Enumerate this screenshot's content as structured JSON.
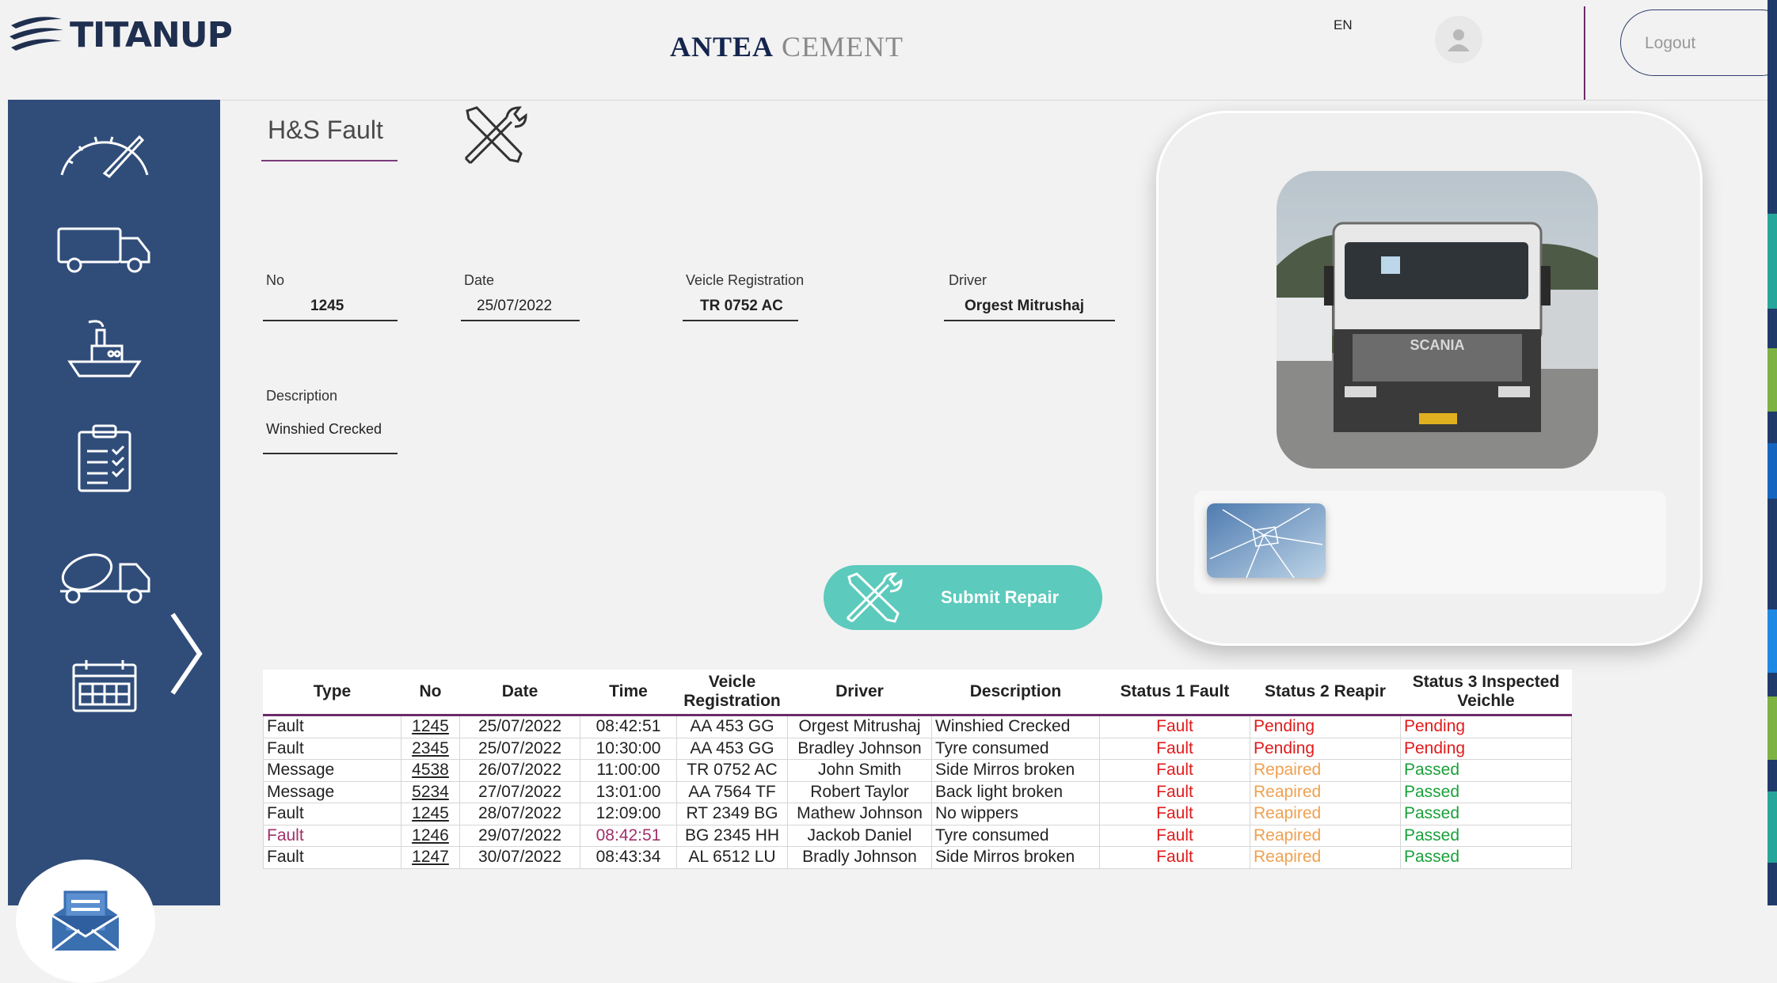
{
  "header": {
    "brand": {
      "name_main": "TITAN",
      "name_tail": "UP"
    },
    "company": {
      "part1": "ANTEA",
      "part2": "CEMENT"
    },
    "language": "EN",
    "logout_label": "Logout"
  },
  "sidebar": {
    "items": [
      {
        "icon": "speedometer-icon"
      },
      {
        "icon": "truck-icon"
      },
      {
        "icon": "ship-icon"
      },
      {
        "icon": "clipboard-checklist-icon"
      },
      {
        "icon": "cement-mixer-icon"
      },
      {
        "icon": "calendar-icon"
      }
    ],
    "expand_icon": "chevron-right-icon",
    "mail_icon": "mail-document-icon"
  },
  "form": {
    "title": "H&S Fault",
    "no": {
      "label": "No",
      "value": "1245"
    },
    "date": {
      "label": "Date",
      "value": "25/07/2022"
    },
    "registration": {
      "label": "Veicle Registration",
      "value": "TR 0752 AC"
    },
    "driver": {
      "label": "Driver",
      "value": "Orgest Mitrushaj"
    },
    "description": {
      "label": "Description",
      "value": "Winshied Crecked"
    },
    "submit_label": "Submit Repair"
  },
  "photo": {
    "truck_brand": "SCANIA"
  },
  "table": {
    "headers": {
      "type": "Type",
      "no": "No",
      "date": "Date",
      "time": "Time",
      "registration": "Veicle Registration",
      "driver": "Driver",
      "description": "Description",
      "status1": "Status 1 Fault",
      "status2": "Status 2 Reapir",
      "status3": "Status 3 Inspected Veichle"
    },
    "rows": [
      {
        "type": "Fault",
        "no": "1245",
        "date": "25/07/2022",
        "time": "08:42:51",
        "registration": "AA 453 GG",
        "driver": "Orgest Mitrushaj",
        "description": "Winshied Crecked",
        "status1": "Fault",
        "status2": "Pending",
        "status3": "Pending"
      },
      {
        "type": "Fault",
        "no": "2345",
        "date": "25/07/2022",
        "time": "10:30:00",
        "registration": "AA 453 GG",
        "driver": "Bradley Johnson",
        "description": "Tyre consumed",
        "status1": "Fault",
        "status2": "Pending",
        "status3": "Pending"
      },
      {
        "type": "Message",
        "no": "4538",
        "date": "26/07/2022",
        "time": "11:00:00",
        "registration": "TR 0752 AC",
        "driver": "John Smith",
        "description": "Side Mirros broken",
        "status1": "Fault",
        "status2": "Repaired",
        "status3": "Passed"
      },
      {
        "type": "Message",
        "no": "5234",
        "date": "27/07/2022",
        "time": "13:01:00",
        "registration": "AA 7564 TF",
        "driver": "Robert Taylor",
        "description": "Back light broken",
        "status1": "Fault",
        "status2": "Reapired",
        "status3": "Passed"
      },
      {
        "type": "Fault",
        "no": "1245",
        "date": "28/07/2022",
        "time": "12:09:00",
        "registration": "RT 2349 BG",
        "driver": "Mathew Johnson",
        "description": "No wippers",
        "status1": "Fault",
        "status2": "Reapired",
        "status3": "Passed"
      },
      {
        "type": "Fault",
        "no": "1246",
        "date": "29/07/2022",
        "time": "08:42:51",
        "registration": "BG 2345 HH",
        "driver": "Jackob Daniel",
        "description": "Tyre consumed",
        "status1": "Fault",
        "status2": "Reapired",
        "status3": "Passed"
      },
      {
        "type": "Fault",
        "no": "1247",
        "date": "30/07/2022",
        "time": "08:43:34",
        "registration": "AL 6512 LU",
        "driver": "Bradly Johnson",
        "description": "Side Mirros broken",
        "status1": "Fault",
        "status2": "Reapired",
        "status3": "Passed"
      }
    ],
    "status_colors": {
      "fault": "#e11b1b",
      "pending": "#e11b1b",
      "repaired": "#f0a050",
      "passed": "#19a13a"
    }
  },
  "colors": {
    "sidebar": "#304d7a",
    "accent_button": "#5ccabc",
    "divider_purple": "#6b2c6b",
    "brand_navy": "#14244e"
  }
}
